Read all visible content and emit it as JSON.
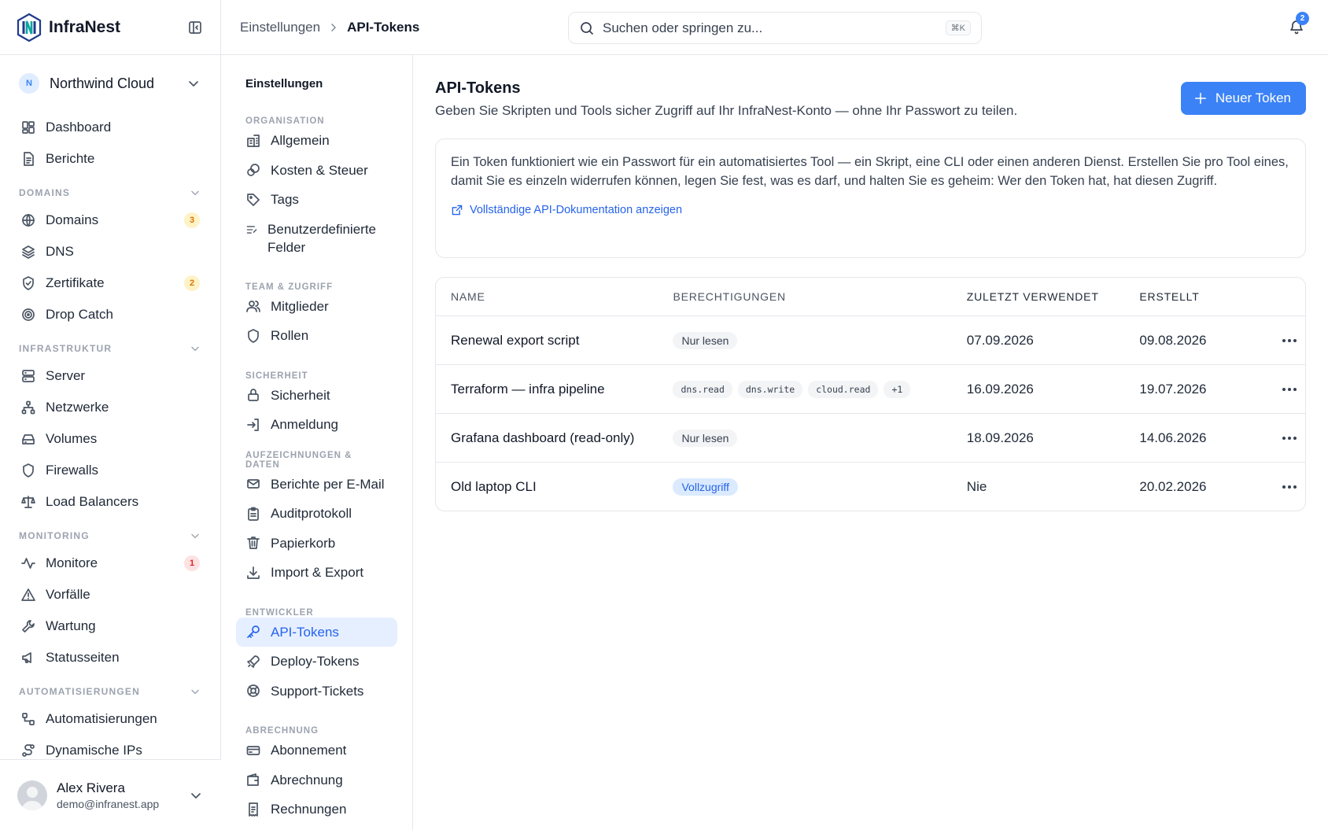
{
  "app": {
    "brand": "InfraNest"
  },
  "org": {
    "initial": "N",
    "name": "Northwind Cloud"
  },
  "sidebar": {
    "top_items": [
      {
        "label": "Dashboard"
      },
      {
        "label": "Berichte"
      }
    ],
    "sections": [
      {
        "title": "DOMAINS",
        "items": [
          {
            "label": "Domains",
            "badge": "3",
            "badge_color": "amber"
          },
          {
            "label": "DNS"
          },
          {
            "label": "Zertifikate",
            "badge": "2",
            "badge_color": "amber"
          },
          {
            "label": "Drop Catch"
          }
        ]
      },
      {
        "title": "INFRASTRUKTUR",
        "items": [
          {
            "label": "Server"
          },
          {
            "label": "Netzwerke"
          },
          {
            "label": "Volumes"
          },
          {
            "label": "Firewalls"
          },
          {
            "label": "Load Balancers"
          }
        ]
      },
      {
        "title": "MONITORING",
        "items": [
          {
            "label": "Monitore",
            "badge": "1",
            "badge_color": "red"
          },
          {
            "label": "Vorfälle"
          },
          {
            "label": "Wartung"
          },
          {
            "label": "Statusseiten"
          }
        ]
      },
      {
        "title": "AUTOMATISIERUNGEN",
        "items": [
          {
            "label": "Automatisierungen"
          },
          {
            "label": "Dynamische IPs"
          }
        ]
      }
    ]
  },
  "user": {
    "name": "Alex Rivera",
    "email": "demo@infranest.app"
  },
  "topbar": {
    "breadcrumb_parent": "Einstellungen",
    "breadcrumb_current": "API-Tokens",
    "search_placeholder": "Suchen oder springen zu...",
    "search_shortcut": "⌘K",
    "notification_count": "2"
  },
  "settings_nav": {
    "title": "Einstellungen",
    "sections": [
      {
        "title": "ORGANISATION",
        "items": [
          "Allgemein",
          "Kosten & Steuer",
          "Tags",
          "Benutzerdefinierte Felder"
        ]
      },
      {
        "title": "TEAM & ZUGRIFF",
        "items": [
          "Mitglieder",
          "Rollen"
        ]
      },
      {
        "title": "SICHERHEIT",
        "items": [
          "Sicherheit",
          "Anmeldung"
        ]
      },
      {
        "title": "AUFZEICHNUNGEN & DATEN",
        "items": [
          "Berichte per E-Mail",
          "Auditprotokoll",
          "Papierkorb",
          "Import & Export"
        ]
      },
      {
        "title": "ENTWICKLER",
        "items": [
          "API-Tokens",
          "Deploy-Tokens",
          "Support-Tickets"
        ]
      },
      {
        "title": "ABRECHNUNG",
        "items": [
          "Abonnement",
          "Abrechnung",
          "Rechnungen"
        ]
      }
    ],
    "active": "API-Tokens"
  },
  "main": {
    "title": "API-Tokens",
    "description": "Geben Sie Skripten und Tools sicher Zugriff auf Ihr InfraNest-Konto — ohne Ihr Passwort zu teilen.",
    "new_button": "Neuer Token",
    "info_text": "Ein Token funktioniert wie ein Passwort für ein automatisiertes Tool — ein Skript, eine CLI oder einen anderen Dienst. Erstellen Sie pro Tool eines, damit Sie es einzeln widerrufen können, legen Sie fest, was es darf, und halten Sie es geheim: Wer den Token hat, hat diesen Zugriff.",
    "doc_link": "Vollständige API-Dokumentation anzeigen"
  },
  "table": {
    "columns": [
      "NAME",
      "BERECHTIGUNGEN",
      "ZULETZT VERWENDET",
      "ERSTELLT"
    ],
    "rows": [
      {
        "name": "Renewal export script",
        "perm_type": "pill",
        "perms": [
          "Nur lesen"
        ],
        "last_used": "07.09.2026",
        "created": "09.08.2026"
      },
      {
        "name": "Terraform — infra pipeline",
        "perm_type": "scopes",
        "perms": [
          "dns.read",
          "dns.write",
          "cloud.read",
          "+1"
        ],
        "last_used": "16.09.2026",
        "created": "19.07.2026"
      },
      {
        "name": "Grafana dashboard (read-only)",
        "perm_type": "pill",
        "perms": [
          "Nur lesen"
        ],
        "last_used": "18.09.2026",
        "created": "14.06.2026"
      },
      {
        "name": "Old laptop CLI",
        "perm_type": "full",
        "perms": [
          "Vollzugriff"
        ],
        "last_used": "Nie",
        "created": "20.02.2026"
      }
    ]
  },
  "colors": {
    "accent": "#3b82f6",
    "active_bg": "#e6efff",
    "border": "#e5e7eb"
  }
}
